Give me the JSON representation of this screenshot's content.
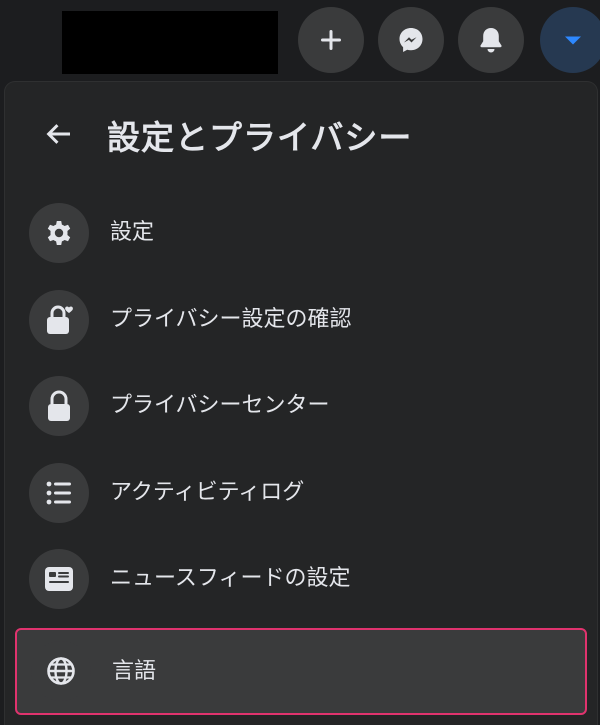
{
  "topbar": {
    "buttons": [
      {
        "icon": "plus-icon"
      },
      {
        "icon": "messenger-icon"
      },
      {
        "icon": "bell-icon"
      },
      {
        "icon": "caret-down-icon"
      }
    ],
    "accent_color": "#2d88ff"
  },
  "panel": {
    "title": "設定とプライバシー",
    "back_icon": "back-arrow-icon",
    "items": [
      {
        "label": "設定",
        "icon": "gear-icon"
      },
      {
        "label": "プライバシー設定の確認",
        "icon": "lock-heart-icon"
      },
      {
        "label": "プライバシーセンター",
        "icon": "lock-icon"
      },
      {
        "label": "アクティビティログ",
        "icon": "list-icon"
      },
      {
        "label": "ニュースフィードの設定",
        "icon": "news-feed-icon"
      },
      {
        "label": "言語",
        "icon": "globe-icon",
        "highlighted": true
      }
    ],
    "highlight_color": "#e0336e"
  }
}
